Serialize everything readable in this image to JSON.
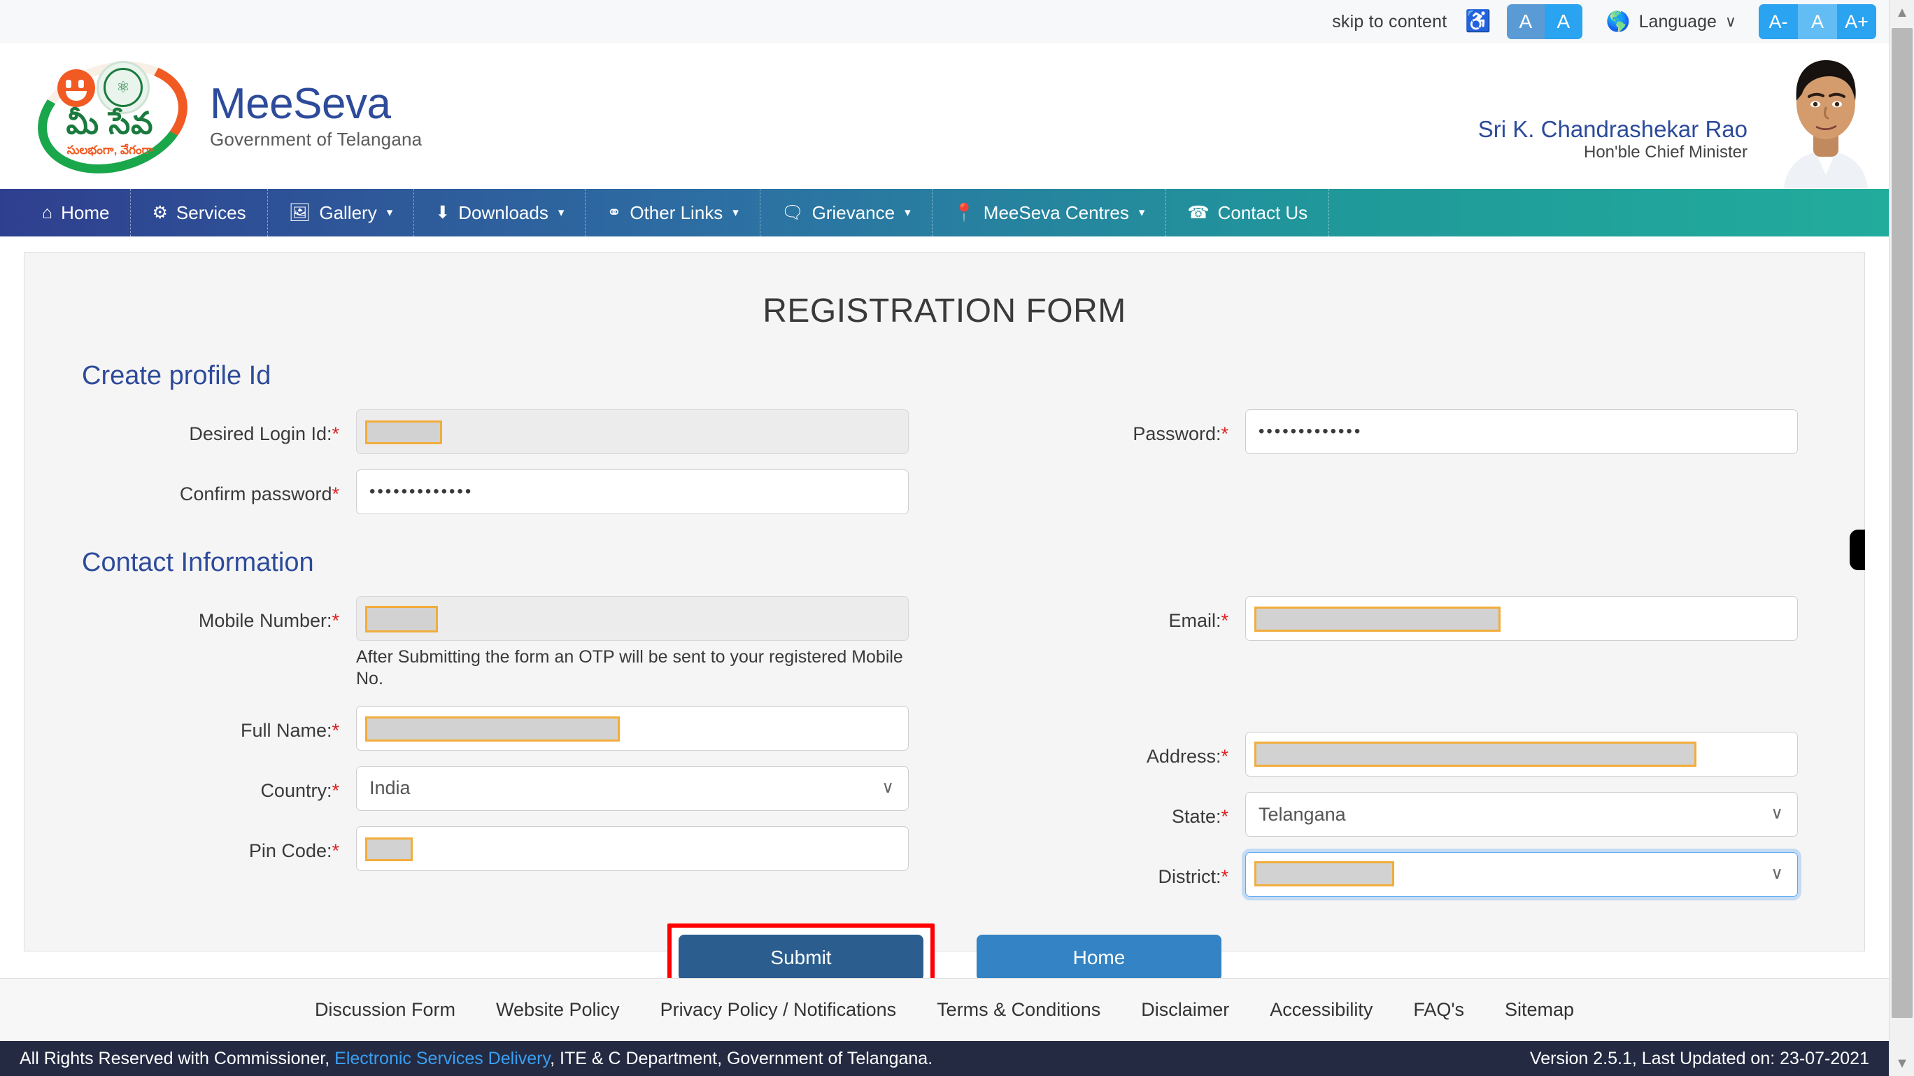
{
  "topbar": {
    "skip_to_content": "skip to content",
    "accessibility_icon": "wheelchair-icon",
    "contrast_a_dim": "A",
    "contrast_a_bright": "A",
    "globe_icon": "globe-icon",
    "language_label": "Language",
    "language_caret": "chevron-down-icon",
    "font_decrease": "A-",
    "font_normal": "A",
    "font_increase": "A+"
  },
  "masthead": {
    "logo_telugu_main": "మీ సేవ",
    "logo_telugu_sub": "సులభంగా, వేగంగా",
    "brand_title": "MeeSeva",
    "brand_subtitle": "Government of Telangana",
    "cm_name": "Sri K. Chandrashekar Rao",
    "cm_role": "Hon'ble Chief Minister"
  },
  "nav": {
    "items": [
      {
        "label": "Home",
        "icon": "home-icon",
        "glyph": "⌂",
        "caret": false
      },
      {
        "label": "Services",
        "icon": "gear-icon",
        "glyph": "⚙",
        "caret": false
      },
      {
        "label": "Gallery",
        "icon": "image-icon",
        "glyph": "ὛC",
        "caret": true
      },
      {
        "label": "Downloads",
        "icon": "download-icon",
        "glyph": "⬇",
        "caret": true
      },
      {
        "label": "Other Links",
        "icon": "link-icon",
        "glyph": "⚭",
        "caret": true
      },
      {
        "label": "Grievance",
        "icon": "comment-icon",
        "glyph": "὞8",
        "caret": true
      },
      {
        "label": "MeeSeva Centres",
        "icon": "map-pin-icon",
        "glyph": "⚑",
        "caret": true
      },
      {
        "label": "Contact Us",
        "icon": "phone-icon",
        "glyph": "☎",
        "caret": false
      }
    ],
    "caret_glyph": "▾"
  },
  "form": {
    "title": "REGISTRATION FORM",
    "sections": {
      "profile": "Create profile Id",
      "contact": "Contact Information"
    },
    "fields": {
      "desired_login_id": {
        "label": "Desired Login Id:",
        "required": true,
        "value": "",
        "state": "disabled",
        "redacted": true
      },
      "password": {
        "label": "Password:",
        "required": true,
        "value": "•••••••••••••",
        "state": "normal",
        "redacted": false
      },
      "confirm_password": {
        "label": "Confirm password",
        "required": true,
        "value": "•••••••••••••",
        "state": "normal",
        "redacted": false
      },
      "mobile_number": {
        "label": "Mobile Number:",
        "required": true,
        "value": "",
        "state": "disabled",
        "redacted": true
      },
      "mobile_helper": "After Submitting the form an OTP will be sent to your registered Mobile No.",
      "email": {
        "label": "Email:",
        "required": true,
        "value": "",
        "state": "normal",
        "redacted": true
      },
      "full_name": {
        "label": "Full Name:",
        "required": true,
        "value": "",
        "state": "normal",
        "redacted": true
      },
      "address": {
        "label": "Address:",
        "required": true,
        "value": "",
        "state": "normal",
        "redacted": true
      },
      "country": {
        "label": "Country:",
        "required": true,
        "value": "India",
        "state": "normal",
        "redacted": false
      },
      "state": {
        "label": "State:",
        "required": true,
        "value": "Telangana",
        "state": "normal",
        "redacted": false
      },
      "pin_code": {
        "label": "Pin Code:",
        "required": true,
        "value": "",
        "state": "normal",
        "redacted": true
      },
      "district": {
        "label": "District:",
        "required": true,
        "value": "",
        "state": "focused",
        "redacted": true
      }
    },
    "buttons": {
      "submit": "Submit",
      "home": "Home"
    },
    "highlight_color": "#ff0000",
    "redaction_border_color": "#f2ad3c",
    "redaction_fill_color": "#d2d2d2"
  },
  "footer": {
    "links": [
      "Discussion Form",
      "Website Policy",
      "Privacy Policy / Notifications",
      "Terms & Conditions",
      "Disclaimer",
      "Accessibility",
      "FAQ's",
      "Sitemap"
    ],
    "copyright_prefix": "All Rights Reserved with Commissioner, ",
    "copyright_link": "Electronic Services Delivery",
    "copyright_suffix": ", ITE & C Department, Government of Telangana.",
    "version": "Version 2.5.1, Last Updated on: 23-07-2021"
  },
  "scrollbar": {
    "up_arrow": "▲",
    "down_arrow": "▼"
  }
}
